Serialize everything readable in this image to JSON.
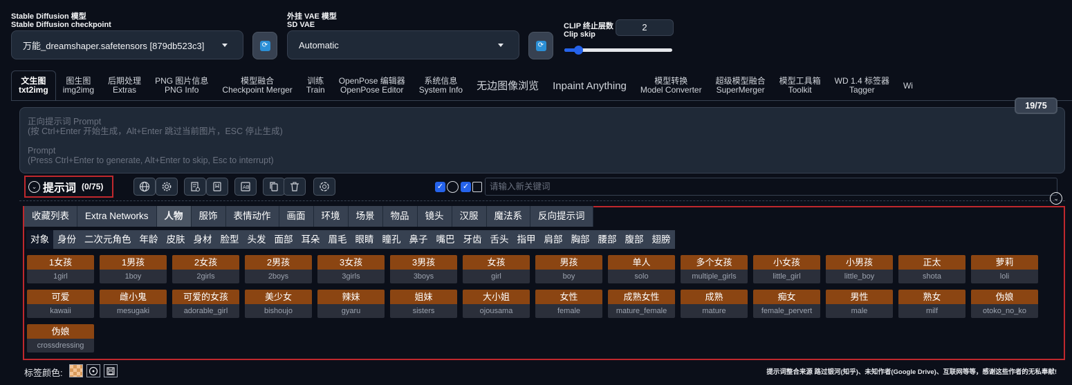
{
  "checkpoint": {
    "label_cn": "Stable Diffusion 模型",
    "label_en": "Stable Diffusion checkpoint",
    "value": "万能_dreamshaper.safetensors [879db523c3]"
  },
  "vae": {
    "label_cn": "外挂 VAE 模型",
    "label_en": "SD VAE",
    "value": "Automatic"
  },
  "clip_skip": {
    "label_cn": "CLIP 终止层数",
    "label_en": "Clip skip",
    "value": "2",
    "slider_fraction": 0.13
  },
  "tabs": [
    {
      "cn": "文生图",
      "en": "txt2img",
      "active": true
    },
    {
      "cn": "图生图",
      "en": "img2img"
    },
    {
      "cn": "后期处理",
      "en": "Extras"
    },
    {
      "cn": "PNG 图片信息",
      "en": "PNG Info"
    },
    {
      "cn": "模型融合",
      "en": "Checkpoint Merger"
    },
    {
      "cn": "训练",
      "en": "Train"
    },
    {
      "cn": "OpenPose 编辑器",
      "en": "OpenPose Editor"
    },
    {
      "cn": "系统信息",
      "en": "System Info"
    },
    {
      "cn": "无边图像浏览",
      "en": ""
    },
    {
      "cn": "Inpaint Anything",
      "en": ""
    },
    {
      "cn": "模型转换",
      "en": "Model Converter"
    },
    {
      "cn": "超级模型融合",
      "en": "SuperMerger"
    },
    {
      "cn": "模型工具箱",
      "en": "Toolkit"
    },
    {
      "cn": "WD 1.4 标签器",
      "en": "Tagger"
    },
    {
      "cn": "",
      "en": "Wi"
    }
  ],
  "prompt": {
    "placeholder_line1": "正向提示词 Prompt",
    "placeholder_line2": "(按 Ctrl+Enter 开始生成，Alt+Enter 跳过当前图片，ESC 停止生成)",
    "placeholder_line3": "Prompt",
    "placeholder_line4": "(Press Ctrl+Enter to generate, Alt+Enter to skip, Esc to interrupt)",
    "token_counter": "19/75"
  },
  "helper": {
    "title": "提示词",
    "count": "(0/75)",
    "keyword_placeholder": "请输入新关键词",
    "icons": [
      "globe-icon",
      "gear-icon",
      "history-icon",
      "bookmark-icon",
      "translate-icon",
      "copy-icon",
      "trash-icon",
      "openai-icon"
    ]
  },
  "categories": [
    "收藏列表",
    "Extra Networks",
    "人物",
    "服饰",
    "表情动作",
    "画面",
    "环境",
    "场景",
    "物品",
    "镜头",
    "汉服",
    "魔法系",
    "反向提示词"
  ],
  "active_category": "人物",
  "subcategories": [
    "对象",
    "身份",
    "二次元角色",
    "年龄",
    "皮肤",
    "身材",
    "脸型",
    "头发",
    "面部",
    "耳朵",
    "眉毛",
    "眼睛",
    "瞳孔",
    "鼻子",
    "嘴巴",
    "牙齿",
    "舌头",
    "指甲",
    "肩部",
    "胸部",
    "腰部",
    "腹部",
    "翅膀"
  ],
  "active_subcategory": "对象",
  "tags": [
    {
      "cn": "1女孩",
      "en": "1girl"
    },
    {
      "cn": "1男孩",
      "en": "1boy"
    },
    {
      "cn": "2女孩",
      "en": "2girls"
    },
    {
      "cn": "2男孩",
      "en": "2boys"
    },
    {
      "cn": "3女孩",
      "en": "3girls"
    },
    {
      "cn": "3男孩",
      "en": "3boys"
    },
    {
      "cn": "女孩",
      "en": "girl"
    },
    {
      "cn": "男孩",
      "en": "boy"
    },
    {
      "cn": "单人",
      "en": "solo"
    },
    {
      "cn": "多个女孩",
      "en": "multiple_girls"
    },
    {
      "cn": "小女孩",
      "en": "little_girl"
    },
    {
      "cn": "小男孩",
      "en": "little_boy"
    },
    {
      "cn": "正太",
      "en": "shota"
    },
    {
      "cn": "萝莉",
      "en": "loli"
    },
    {
      "cn": "可爱",
      "en": "kawaii"
    },
    {
      "cn": "雌小鬼",
      "en": "mesugaki"
    },
    {
      "cn": "可爱的女孩",
      "en": "adorable_girl"
    },
    {
      "cn": "美少女",
      "en": "bishoujo"
    },
    {
      "cn": "辣妹",
      "en": "gyaru"
    },
    {
      "cn": "姐妹",
      "en": "sisters"
    },
    {
      "cn": "大小姐",
      "en": "ojousama"
    },
    {
      "cn": "女性",
      "en": "female"
    },
    {
      "cn": "成熟女性",
      "en": "mature_female"
    },
    {
      "cn": "成熟",
      "en": "mature"
    },
    {
      "cn": "痴女",
      "en": "female_pervert"
    },
    {
      "cn": "男性",
      "en": "male"
    },
    {
      "cn": "熟女",
      "en": "milf"
    },
    {
      "cn": "伪娘",
      "en": "otoko_no_ko"
    },
    {
      "cn": "伪娘",
      "en": "crossdressing"
    }
  ],
  "footer": {
    "color_label": "标签颜色:",
    "credit": "提示词整合来源 路过银河(知乎)、未知作者(Google Drive)、互联网等等，感谢这些作者的无私奉献!"
  },
  "colors": {
    "background": "#0b0f19",
    "tag_cn_bg": "#8b4512",
    "tag_en_bg": "#2b2f3a",
    "accent": "#2563eb",
    "highlight_border": "#c0282d"
  }
}
